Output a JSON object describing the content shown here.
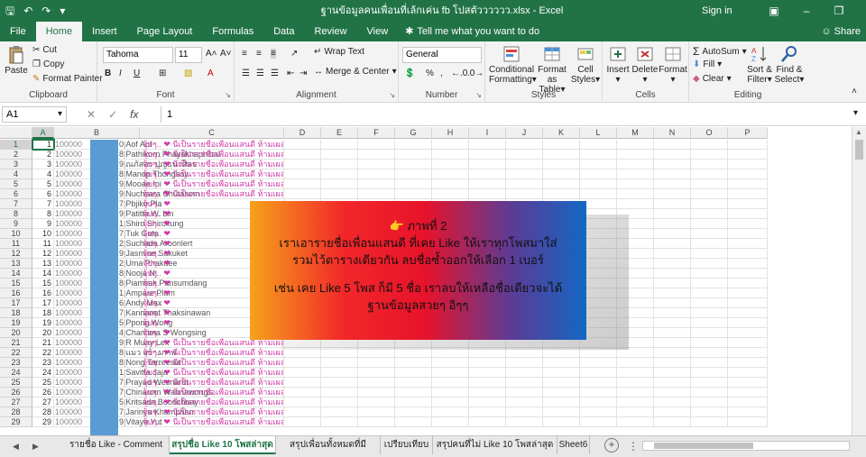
{
  "window": {
    "title": "ฐานข้อมูลคนเพื่อนที่เล้กเค่น fb โปสตัวววววว.xlsx - Excel",
    "signin": "Sign in",
    "share": "Share",
    "tell_me": "Tell me what you want to do"
  },
  "tabs": [
    "File",
    "Home",
    "Insert",
    "Page Layout",
    "Formulas",
    "Data",
    "Review",
    "View"
  ],
  "active_tab": "Home",
  "ribbon": {
    "clipboard": {
      "label": "Clipboard",
      "paste": "Paste",
      "cut": "Cut",
      "copy": "Copy",
      "painter": "Format Painter"
    },
    "font": {
      "label": "Font",
      "name": "Tahoma",
      "size": "11"
    },
    "alignment": {
      "label": "Alignment",
      "wrap": "Wrap Text",
      "merge": "Merge & Center"
    },
    "number": {
      "label": "Number",
      "format": "General"
    },
    "styles": {
      "label": "Styles",
      "conditional": "Conditional",
      "conditional2": "Formatting",
      "format_as": "Format as",
      "format_as2": "Table",
      "cell": "Cell",
      "cell2": "Styles"
    },
    "cells": {
      "label": "Cells",
      "insert": "Insert",
      "delete": "Delete",
      "format": "Format"
    },
    "editing": {
      "label": "Editing",
      "autosum": "AutoSum",
      "fill": "Fill",
      "clear": "Clear",
      "sort": "Sort &",
      "sort2": "Filter",
      "find": "Find &",
      "find2": "Select"
    }
  },
  "formula_bar": {
    "name_box": "A1",
    "value": "1"
  },
  "columns": [
    "A",
    "B",
    "C",
    "D",
    "E",
    "F",
    "G",
    "H",
    "I",
    "J",
    "K",
    "L",
    "M",
    "N",
    "O",
    "P"
  ],
  "rows": [
    {
      "n": "1",
      "a": "1",
      "id": "100000",
      "tail": "0",
      "name": "Aof Aof",
      "c": "จุ้บๆ.. ❤ นี่เป็นรายชื่อเพื่อนแสนดี ห้ามเผลอลบ"
    },
    {
      "n": "2",
      "a": "2",
      "id": "100000",
      "tail": "8",
      "name": "Pathikorn Phayakhaphibal",
      "c": "จุ้บๆ.. ❤ นี่เป็นรายชื่อเพื่อนแสนดี ห้ามเผลอลบ"
    },
    {
      "n": "3",
      "a": "3",
      "id": "100000",
      "tail": "9",
      "name": "ณภัสอร ปูญธนาศิลธ",
      "c": "จุ้บๆ.. ❤ นี่เป็นรายชื่อเพื่อนแสนดี ห้ามเผลอลบ"
    },
    {
      "n": "4",
      "a": "4",
      "id": "100000",
      "tail": "8",
      "name": "Manop Thongsoy",
      "c": "จุ้บๆ.. ❤ นี่เป็นรายชื่อเพื่อนแสนดี ห้ามเผลอลบ"
    },
    {
      "n": "5",
      "a": "5",
      "id": "100000",
      "tail": "9",
      "name": "Mooae Ioi",
      "c": "จุ้บๆ.. ❤ นี่เป็นรายชื่อเพื่อนแสนดี ห้ามเผลอลบ"
    },
    {
      "n": "6",
      "a": "6",
      "id": "100000",
      "tail": "9",
      "name": "Nuchsara Chutasom",
      "c": "จุ้บๆ.. ❤ นี่เป็นรายชื่อเพื่อนแสนดี ห้ามเผลอลบ"
    },
    {
      "n": "7",
      "a": "7",
      "id": "100000",
      "tail": "7",
      "name": "Pbjiko Pla",
      "c": "จุ้บๆ.. ❤"
    },
    {
      "n": "8",
      "a": "8",
      "id": "100000",
      "tail": "9",
      "name": "Patitta W. Lin",
      "c": "จุ้บๆ.. ❤"
    },
    {
      "n": "9",
      "a": "9",
      "id": "100000",
      "tail": "1",
      "name": "Shiro Shirokung",
      "c": "จุ้บๆ.. ❤"
    },
    {
      "n": "10",
      "a": "10",
      "id": "100000",
      "tail": "7",
      "name": "Tuk Gata",
      "c": "จุ้บๆ.. ❤"
    },
    {
      "n": "11",
      "a": "11",
      "id": "100000",
      "tail": "2",
      "name": "Suchada Aroonlert",
      "c": "จุ้บๆ.. ❤"
    },
    {
      "n": "12",
      "a": "12",
      "id": "100000",
      "tail": "9",
      "name": "Jasmine Sakuket",
      "c": "จุ้บๆ.. ❤"
    },
    {
      "n": "13",
      "a": "13",
      "id": "100000",
      "tail": "2",
      "name": "Uma Phakdee",
      "c": "จุ้บๆ.. ❤"
    },
    {
      "n": "14",
      "a": "14",
      "id": "100000",
      "tail": "8",
      "name": "Nooja Nj",
      "c": "จุ้บๆ.. ❤"
    },
    {
      "n": "15",
      "a": "15",
      "id": "100000",
      "tail": "8",
      "name": "Piamsak Pansumdang",
      "c": "จุ้บๆ.. ❤"
    },
    {
      "n": "16",
      "a": "16",
      "id": "100000",
      "tail": "1",
      "name": "Ampare Plum",
      "c": "จุ้บๆ.. ❤"
    },
    {
      "n": "17",
      "a": "17",
      "id": "100000",
      "tail": "6",
      "name": "Andy Max",
      "c": "จุ้บๆ.. ❤"
    },
    {
      "n": "18",
      "a": "18",
      "id": "100000",
      "tail": "7",
      "name": "Kannanat Thaksinawan",
      "c": "จุ้บๆ.. ❤"
    },
    {
      "n": "19",
      "a": "19",
      "id": "100000",
      "tail": "5",
      "name": "Ppong Wong",
      "c": "จุ้บๆ.. ❤"
    },
    {
      "n": "20",
      "a": "20",
      "id": "100000",
      "tail": "4",
      "name": "Chantima S Wongsing",
      "c": "จุ้บๆ.. ❤"
    },
    {
      "n": "21",
      "a": "21",
      "id": "100000",
      "tail": "9",
      "name": "R Muay Lek",
      "c": "จุ้บๆ.. ❤ นี่เป็นรายชื่อเพื่อนแสนดี ห้ามเผลอลบ"
    },
    {
      "n": "22",
      "a": "22",
      "id": "100000",
      "tail": "8",
      "name": "แมว สร้างภาพ",
      "c": "จุ้บๆ.. ❤ นี่เป็นรายชื่อเพื่อนแสนดี ห้ามเผลอลบ"
    },
    {
      "n": "23",
      "a": "23",
      "id": "100000",
      "tail": "8",
      "name": "Nong Tarreesut",
      "c": "จุ้บๆ.. ❤ นี่เป็นรายชื่อเพื่อนแสนดี ห้ามเผลอลบ"
    },
    {
      "n": "24",
      "a": "24",
      "id": "100000",
      "tail": "1",
      "name": "Savitta Jaja",
      "c": "จุ้บๆ.. ❤ นี่เป็นรายชื่อเพื่อนแสนดี ห้ามเผลอลบ"
    },
    {
      "n": "25",
      "a": "25",
      "id": "100000",
      "tail": "7",
      "name": "Prayad Wesnarat",
      "c": "จุ้บๆ.. ❤ นี่เป็นรายชื่อเพื่อนแสนดี ห้ามเผลอลบ"
    },
    {
      "n": "26",
      "a": "26",
      "id": "100000",
      "tail": "7",
      "name": "Chinarom Wannawongs",
      "c": "จุ้บๆ.. ❤ นี่เป็นรายชื่อเพื่อนแสนดี ห้ามเผลอลบ"
    },
    {
      "n": "27",
      "a": "27",
      "id": "100000",
      "tail": "5",
      "name": "Kritsada Boonchuay",
      "c": "จุ้บๆ.. ❤ นี่เป็นรายชื่อเพื่อนแสนดี ห้ามเผลอลบ"
    },
    {
      "n": "28",
      "a": "28",
      "id": "100000",
      "tail": "7",
      "name": "Jarinya Khamphan",
      "c": "จุ้บๆ.. ❤ นี่เป็นรายชื่อเพื่อนแสนดี ห้ามเผลอลบ"
    },
    {
      "n": "29",
      "a": "29",
      "id": "100000",
      "tail": "9",
      "name": "Vitaya Yut",
      "c": "จุ้บๆ.. ❤ นี่เป็นรายชื่อเพื่อนแสนดี ห้ามเผลอลบ"
    }
  ],
  "overlay": {
    "line1": "👉 ภาพที่ 2",
    "line2": "เราเอารายชื่อเพื่อนแสนดี ที่เคย Like ให้เราทุกโพสมาใส่",
    "line3": "รวมไว้ตารางเดียวกัน ลบชื่อซ้ำออกให้เลือก 1 เบอร์",
    "line4": "เช่น เคย Like 5 โพส ก็มี 5 ชื่อ เราลบให้เหลือชื่อเดียวจะได้",
    "line5": "ฐานข้อมูลสวยๆ อิๆๆ"
  },
  "sheets": [
    {
      "label": "รายชื่อ Like - Comment",
      "active": false
    },
    {
      "label": "สรุปชื่อ Like 10 โพสล่าสุด",
      "active": true
    },
    {
      "label": "สรุปเพื่อนทั้งหมดที่มี",
      "active": false
    },
    {
      "label": "เปรียบเทียบ",
      "active": false
    },
    {
      "label": "สรุปคนที่ไม่ Like 10 โพสล่าสุด",
      "active": false
    },
    {
      "label": "Sheet6",
      "active": false
    }
  ],
  "colors": {
    "accent": "#217346",
    "name_col_bar": "#5b9bd5",
    "pink_text": "#d03aa8"
  }
}
